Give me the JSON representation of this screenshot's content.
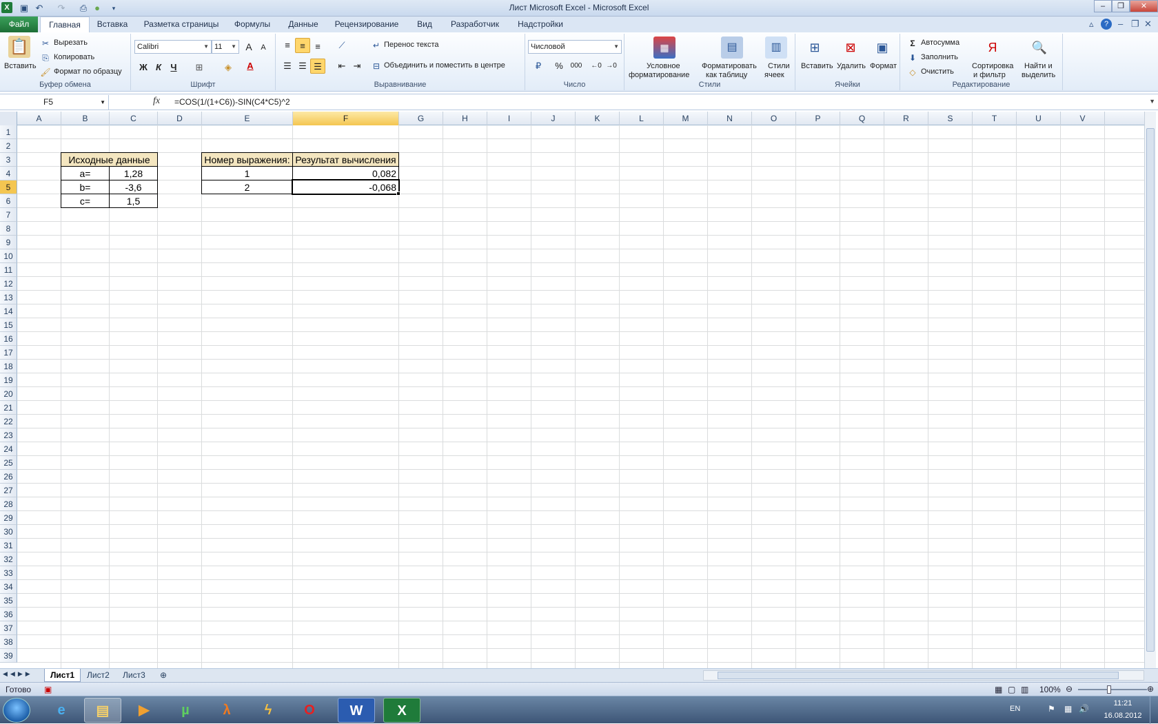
{
  "window": {
    "title": "Лист Microsoft Excel  -  Microsoft Excel",
    "app_icon": "X"
  },
  "qat": [
    "save-icon",
    "undo-icon",
    "redo-icon",
    "print-preview-icon",
    "spellcheck-icon",
    "customize-icon"
  ],
  "menu": {
    "file": "Файл",
    "tabs": [
      "Главная",
      "Вставка",
      "Разметка страницы",
      "Формулы",
      "Данные",
      "Рецензирование",
      "Вид",
      "Разработчик",
      "Надстройки"
    ]
  },
  "ribbon": {
    "clipboard": {
      "paste": "Вставить",
      "cut": "Вырезать",
      "copy": "Копировать",
      "format_painter": "Формат по образцу",
      "label": "Буфер обмена"
    },
    "font": {
      "name": "Calibri",
      "size": "11",
      "bold": "Ж",
      "italic": "К",
      "underline": "Ч",
      "grow": "A",
      "shrink": "A",
      "font_color": "A",
      "label": "Шрифт"
    },
    "alignment": {
      "wrap": "Перенос текста",
      "merge": "Объединить и поместить в центре",
      "label": "Выравнивание"
    },
    "number": {
      "format": "Числовой",
      "percent": "%",
      "thousands": "000",
      "label": "Число"
    },
    "styles": {
      "conditional": [
        "Условное",
        "форматирование"
      ],
      "as_table": [
        "Форматировать",
        "как таблицу"
      ],
      "cell_styles": [
        "Стили",
        "ячеек"
      ],
      "label": "Стили"
    },
    "cells": {
      "insert": "Вставить",
      "delete": "Удалить",
      "format": "Формат",
      "label": "Ячейки"
    },
    "editing": {
      "autosum": "Автосумма",
      "fill": "Заполнить",
      "clear": "Очистить",
      "sort": [
        "Сортировка",
        "и фильтр"
      ],
      "find": [
        "Найти и",
        "выделить"
      ],
      "label": "Редактирование"
    }
  },
  "formula_bar": {
    "name_box": "F5",
    "fx": "fx",
    "formula": "=COS(1/(1+C6))-SIN(C4*C5)^2"
  },
  "columns": [
    "A",
    "B",
    "C",
    "D",
    "E",
    "F",
    "G",
    "H",
    "I",
    "J",
    "K",
    "L",
    "M",
    "N",
    "O",
    "P",
    "Q",
    "R",
    "S",
    "T",
    "U",
    "V"
  ],
  "active_column": "F",
  "rows": [
    "1",
    "2",
    "3",
    "4",
    "5",
    "6",
    "7",
    "8",
    "9",
    "10",
    "11",
    "12",
    "13",
    "14",
    "15",
    "16",
    "17",
    "18",
    "19",
    "20",
    "21",
    "22",
    "23",
    "24",
    "25",
    "26",
    "27",
    "28",
    "29",
    "30",
    "31",
    "32",
    "33",
    "34",
    "35",
    "36",
    "37",
    "38",
    "39"
  ],
  "active_row": "5",
  "cells": {
    "B3": "Исходные данные",
    "B4": "a=",
    "C4": "1,28",
    "B5": "b=",
    "C5": "-3,6",
    "B6": "c=",
    "C6": "1,5",
    "E3": "Номер выражения:",
    "F3": "Результат вычисления",
    "E4": "1",
    "F4": "0,082",
    "E5": "2",
    "F5": "-0,068"
  },
  "sheets": [
    "Лист1",
    "Лист2",
    "Лист3"
  ],
  "active_sheet": "Лист1",
  "status": {
    "ready": "Готово",
    "zoom": "100%"
  },
  "taskbar": {
    "lang": "EN",
    "time": "11:21",
    "date": "16.08.2012",
    "apps": [
      "ie-icon",
      "explorer-icon",
      "media-player-icon",
      "utorrent-icon",
      "half-life-icon",
      "winamp-icon",
      "opera-icon",
      "word-icon",
      "excel-icon"
    ]
  },
  "colors": {
    "file_tab": "#1f7b3a",
    "header_fill": "#f4e6c0",
    "active_header": "#f4c651"
  }
}
